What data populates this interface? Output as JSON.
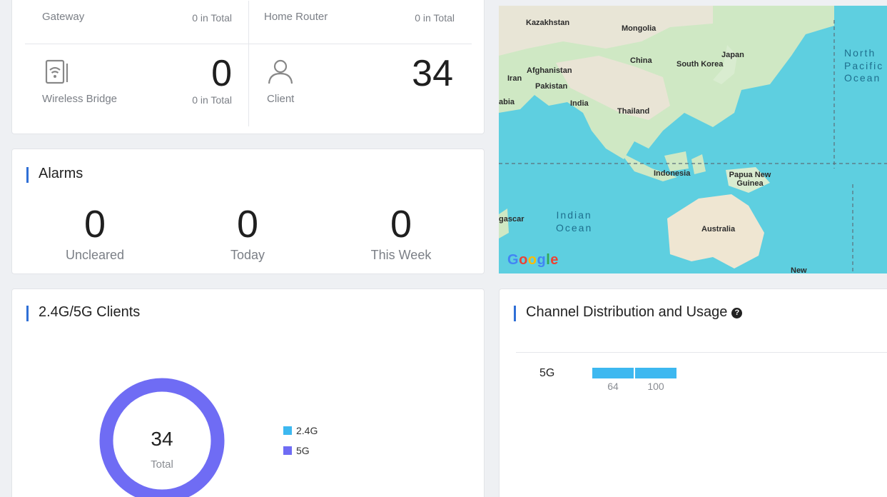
{
  "devices": {
    "gateway": {
      "name": "Gateway",
      "total": "0 in Total"
    },
    "home_router": {
      "name": "Home Router",
      "total": "0 in Total"
    },
    "wireless_bridge": {
      "name": "Wireless Bridge",
      "count": "0",
      "total": "0 in Total",
      "icon": "wifi-bridge-icon"
    },
    "client": {
      "name": "Client",
      "count": "34",
      "icon": "user-icon"
    }
  },
  "alarms": {
    "title": "Alarms",
    "items": [
      {
        "value": "0",
        "label": "Uncleared"
      },
      {
        "value": "0",
        "label": "Today"
      },
      {
        "value": "0",
        "label": "This Week"
      }
    ]
  },
  "map": {
    "labels": [
      "Kazakhstan",
      "Mongolia",
      "China",
      "Japan",
      "South Korea",
      "Afghanistan",
      "Iran",
      "Pakistan",
      "India",
      "Thailand",
      "abia",
      "Indonesia",
      "Papua New Guinea",
      "Australia",
      "gascar",
      "New"
    ],
    "oceans": {
      "indian": "Indian\nOcean",
      "pacific": "North\nPacific\nOcean"
    },
    "logo": "Google"
  },
  "clients": {
    "title": "2.4G/5G Clients",
    "total_value": "34",
    "total_label": "Total",
    "legend": [
      {
        "label": "2.4G",
        "color": "#3db8f0"
      },
      {
        "label": "5G",
        "color": "#6f6cf4"
      }
    ],
    "chart_data": {
      "type": "pie",
      "categories": [
        "2.4G",
        "5G"
      ],
      "values": [
        0,
        34
      ]
    }
  },
  "channel": {
    "title": "Channel Distribution and Usage",
    "band": "5G",
    "channels": [
      "64",
      "100"
    ]
  }
}
